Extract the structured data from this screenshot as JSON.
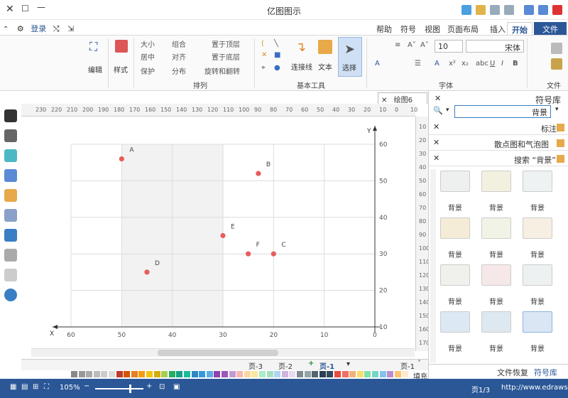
{
  "window": {
    "title": "亿图图示"
  },
  "tabs": [
    "文件",
    "开始",
    "插入",
    "页面布局",
    "视图",
    "符号",
    "帮助"
  ],
  "quick_access": {
    "login_label": "登录"
  },
  "ribbon": {
    "groups": [
      {
        "label": "文件"
      },
      {
        "label": "字体"
      },
      {
        "label": "基本工具"
      },
      {
        "label": "排列"
      }
    ],
    "font_name": "宋体",
    "font_size": "10",
    "tool_select": "选择",
    "tool_text": "文本",
    "tool_connector": "连接线",
    "arrange": [
      "置于顶层",
      "置于底层",
      "旋转和翻转",
      "组合",
      "对齐",
      "分布",
      "大小",
      "居中",
      "保护"
    ],
    "style_label": "样式",
    "edit_label": "编辑"
  },
  "document_tab": {
    "label": "绘图6"
  },
  "hruler_ticks": [
    "10",
    "0",
    "10",
    "20",
    "30",
    "40",
    "50",
    "60",
    "70",
    "80",
    "90",
    "100",
    "110",
    "120",
    "130",
    "140",
    "150",
    "160",
    "170",
    "180",
    "190",
    "200",
    "210",
    "220",
    "230"
  ],
  "vruler_ticks": [
    "10",
    "20",
    "30",
    "40",
    "50",
    "60",
    "70",
    "80",
    "90",
    "100",
    "110",
    "120",
    "130",
    "140",
    "150",
    "160",
    "170"
  ],
  "chart_data": {
    "type": "scatter",
    "xlabel": "X",
    "ylabel": "Y",
    "xlim": [
      0,
      60
    ],
    "ylim": [
      10,
      60
    ],
    "xticks": [
      "0",
      "10",
      "20",
      "30",
      "40",
      "50",
      "60"
    ],
    "yticks": [
      "10",
      "20",
      "30",
      "40",
      "50",
      "60"
    ],
    "points": [
      {
        "label": "A",
        "x": 50,
        "y": 56
      },
      {
        "label": "B",
        "x": 23,
        "y": 52
      },
      {
        "label": "E",
        "x": 30,
        "y": 35
      },
      {
        "label": "F",
        "x": 25,
        "y": 30
      },
      {
        "label": "C",
        "x": 20,
        "y": 30
      },
      {
        "label": "D",
        "x": 45,
        "y": 25
      }
    ],
    "point_color": "#e85c5c",
    "shaded_band": [
      30,
      50
    ],
    "grid": true
  },
  "page_tabs": {
    "pages": [
      "页-1",
      "页-2",
      "页-3"
    ],
    "active": "页-1"
  },
  "status": {
    "url": "http://www.edrawsoft.cn/",
    "page_info": "页1/3",
    "zoom": "105%",
    "fill_label": "填充"
  },
  "right_panel": {
    "title": "符号库",
    "search_value": "背景",
    "libraries": [
      "标注",
      "散点图和气泡图",
      "搜索 “背景”"
    ],
    "thumbnails": [
      "背景",
      "背景",
      "背景",
      "背景",
      "背景",
      "背景",
      "背景",
      "背景",
      "背景",
      "背景",
      "背景",
      "背景"
    ],
    "bottom_tabs": [
      "符号库",
      "文件恢复"
    ]
  }
}
